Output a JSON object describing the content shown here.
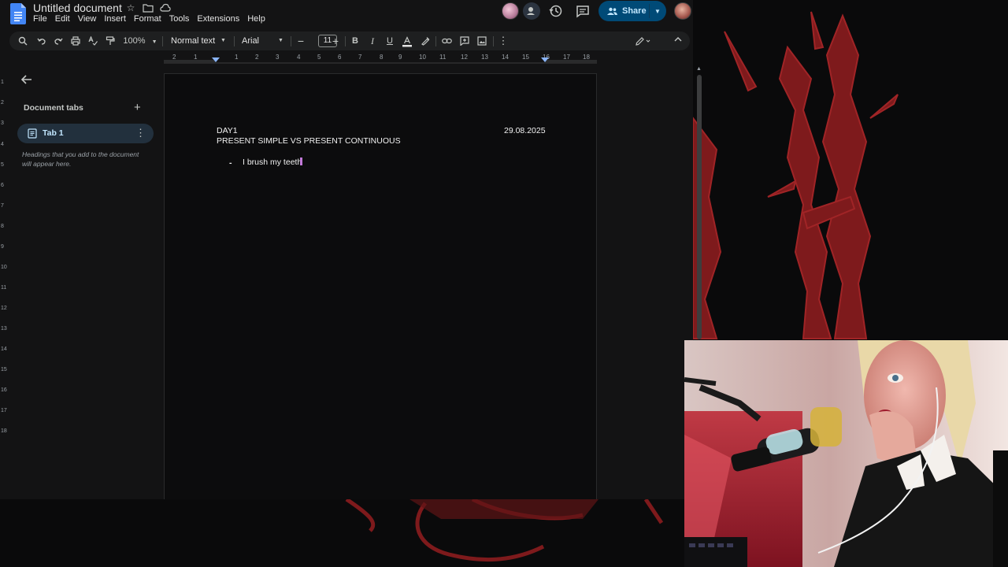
{
  "header": {
    "doc_title": "Untitled document",
    "menu": [
      "File",
      "Edit",
      "View",
      "Insert",
      "Format",
      "Tools",
      "Extensions",
      "Help"
    ],
    "share_label": "Share"
  },
  "toolbar": {
    "zoom": "100%",
    "style": "Normal text",
    "font": "Arial",
    "font_size": "11"
  },
  "ruler": {
    "ticks": [
      "2",
      "1",
      "1",
      "2",
      "3",
      "4",
      "5",
      "6",
      "7",
      "8",
      "9",
      "10",
      "11",
      "12",
      "13",
      "14",
      "15",
      "16",
      "17",
      "18"
    ]
  },
  "vertical_ruler": {
    "ticks": [
      "1",
      "2",
      "3",
      "4",
      "5",
      "6",
      "7",
      "8",
      "9",
      "10",
      "11",
      "12",
      "13",
      "14",
      "15",
      "16",
      "17",
      "18"
    ]
  },
  "sidebar": {
    "title": "Document tabs",
    "tab_label": "Tab 1",
    "hint": "Headings that you add to the document will appear here."
  },
  "document": {
    "line1_left": "DAY1",
    "line1_right": "29.08.2025",
    "line2": "PRESENT SIMPLE VS PRESENT CONTINUOUS",
    "bullet_marker": "-",
    "bullet_text": "I brush my teeth"
  },
  "colors": {
    "app_bg": "#131314",
    "page_bg": "#0c0c0d",
    "share_bg": "#004a77",
    "active_tab_bg": "#22303d",
    "cursor": "#c27ad8",
    "art_red": "#8c1d1f"
  }
}
